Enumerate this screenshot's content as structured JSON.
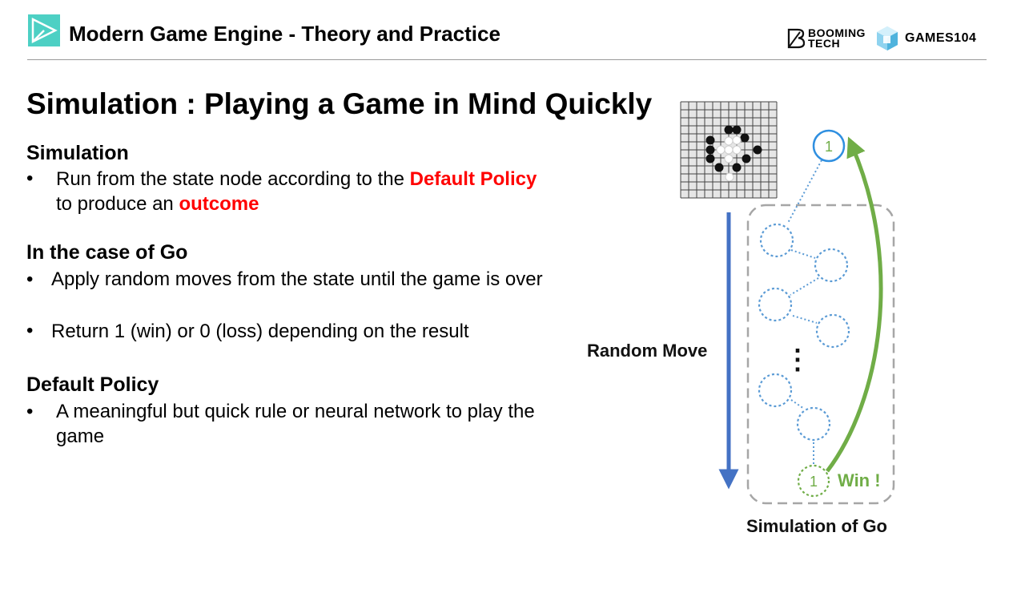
{
  "header": {
    "title": "Modern Game Engine - Theory and Practice",
    "brand_booming_line1": "BOOMING",
    "brand_booming_line2": "TECH",
    "brand_games": "GAMES104",
    "accent_color": "#4dd0c4"
  },
  "slide": {
    "title": "Simulation : Playing a Game in Mind Quickly",
    "sections": [
      {
        "heading": "Simulation",
        "bullets": [
          {
            "parts": [
              "Run from the state node according to the ",
              "Default Policy",
              "to produce an ",
              "outcome"
            ]
          }
        ]
      },
      {
        "heading": "In the case of Go",
        "bullets": [
          {
            "text": "Apply random moves from the state until the game is over"
          },
          {
            "text": "Return 1 (win) or 0 (loss) depending on the result"
          }
        ]
      },
      {
        "heading": "Default Policy",
        "bullets": [
          {
            "text": "A meaningful but quick rule or neural network to play the game"
          }
        ]
      }
    ],
    "bullet_symbol": "•"
  },
  "diagram": {
    "root_node_value": "1",
    "leaf_node_value": "1",
    "ellipsis": "⋮",
    "random_move_label": "Random Move",
    "win_label": "Win !",
    "caption": "Simulation of Go",
    "colors": {
      "random_move_arrow": "#4472c4",
      "backprop_arrow": "#70ad47",
      "node_outline": "#5b9bd5",
      "win_color": "#70ad47",
      "root_outline": "#2f8fe0",
      "dashed_box": "#a6a6a6"
    }
  }
}
